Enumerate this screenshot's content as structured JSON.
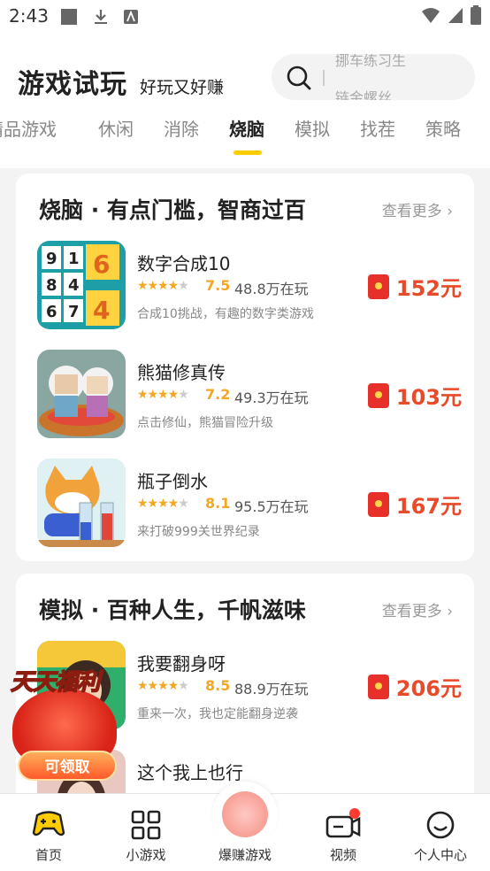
{
  "status_bar": {
    "time": "2:43"
  },
  "header": {
    "title": "游戏试玩",
    "subtitle": "好玩又好赚",
    "search_hints": [
      "挪车练习生",
      "链金螺丝"
    ]
  },
  "tabs": [
    {
      "label": "精品游戏"
    },
    {
      "label": "休闲"
    },
    {
      "label": "消除"
    },
    {
      "label": "烧脑"
    },
    {
      "label": "模拟"
    },
    {
      "label": "找茬"
    },
    {
      "label": "策略"
    }
  ],
  "sections": [
    {
      "title": "烧脑 · 有点门槛，智商过百",
      "more": "查看更多 ›",
      "games": [
        {
          "name": "数字合成10",
          "rating": "7.5",
          "players": "48.8万在玩",
          "desc": "合成10挑战，有趣的数字类游戏",
          "reward": "152元"
        },
        {
          "name": "熊猫修真传",
          "rating": "7.2",
          "players": "49.3万在玩",
          "desc": "点击修仙，熊猫冒险升级",
          "reward": "103元"
        },
        {
          "name": "瓶子倒水",
          "rating": "8.1",
          "players": "95.5万在玩",
          "desc": "来打破999关世界纪录",
          "reward": "167元"
        }
      ]
    },
    {
      "title": "模拟 · 百种人生，千帆滋味",
      "more": "查看更多 ›",
      "games": [
        {
          "name": "我要翻身呀",
          "rating": "8.5",
          "players": "88.9万在玩",
          "desc": "重来一次，我也定能翻身逆袭",
          "reward": "206元"
        },
        {
          "name": "这个我上也行",
          "rating": "",
          "players": "",
          "desc": "",
          "reward": ""
        }
      ]
    }
  ],
  "floater": {
    "title_a": "天天",
    "title_b": "福利",
    "button": "可领取"
  },
  "bottom_nav": [
    {
      "label": "首页"
    },
    {
      "label": "小游戏"
    },
    {
      "label": "爆赚游戏"
    },
    {
      "label": "视频"
    },
    {
      "label": "个人中心"
    }
  ],
  "colors": {
    "accent": "#ffcc00",
    "reward": "#e84a2a",
    "star": "#f5a623"
  }
}
